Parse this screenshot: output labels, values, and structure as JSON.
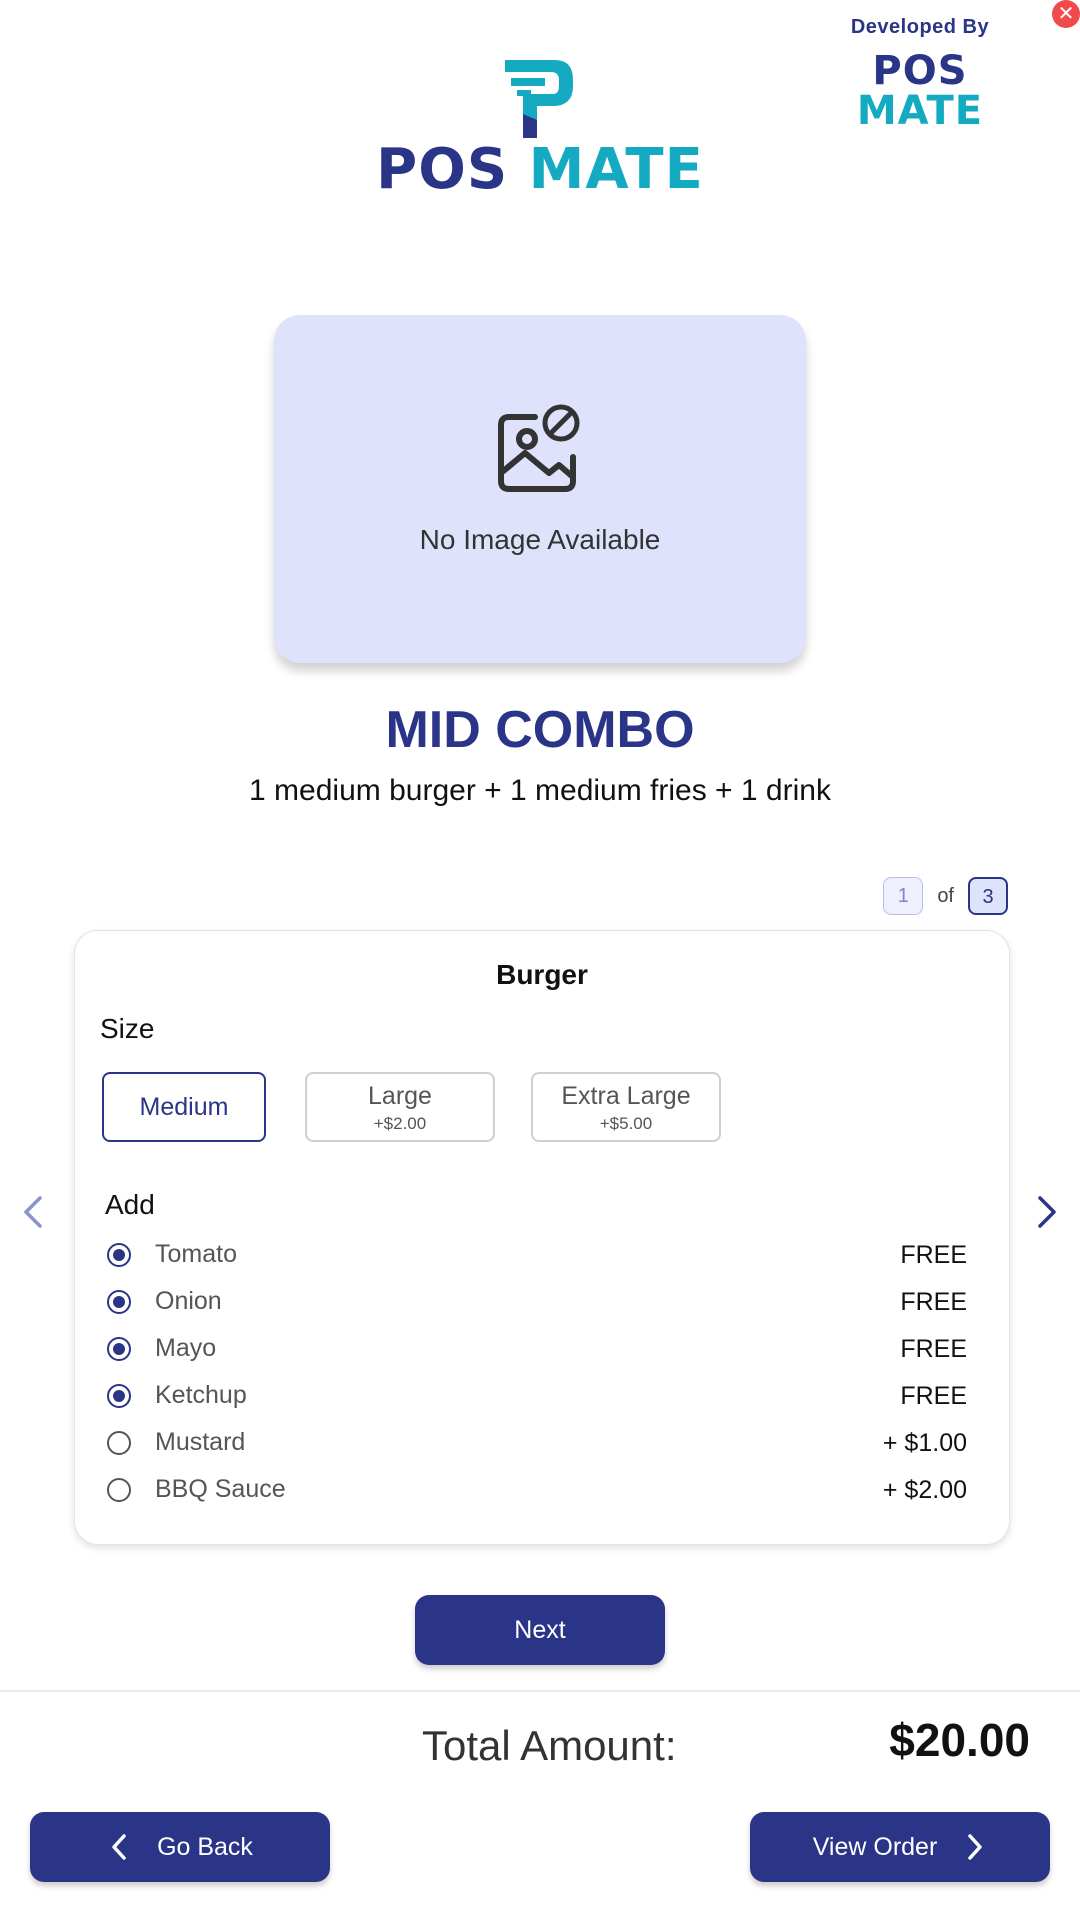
{
  "colors": {
    "primary": "#2a3588",
    "accent": "#13aac2",
    "close": "#f04a4a",
    "image_bg": "#dfe2fb"
  },
  "header": {
    "close_icon": "close-icon",
    "developed_by": {
      "label": "Developed By",
      "brand_a": "POS",
      "brand_b": "MATE"
    },
    "logo": {
      "brand_a": "POS",
      "brand_b": "MATE"
    }
  },
  "product": {
    "image_placeholder": "No Image Available",
    "image_icon": "no-image-icon",
    "title": "MID COMBO",
    "description": "1 medium burger + 1 medium fries + 1 drink"
  },
  "pager": {
    "current": "1",
    "of": "of",
    "total": "3"
  },
  "customize": {
    "title": "Burger",
    "size_label": "Size",
    "sizes": [
      {
        "name": "Medium",
        "price": "",
        "selected": true
      },
      {
        "name": "Large",
        "price": "+$2.00",
        "selected": false
      },
      {
        "name": "Extra Large",
        "price": "+$5.00",
        "selected": false
      }
    ],
    "add_label": "Add",
    "addons": [
      {
        "name": "Tomato",
        "price": "FREE",
        "checked": true
      },
      {
        "name": "Onion",
        "price": "FREE",
        "checked": true
      },
      {
        "name": "Mayo",
        "price": "FREE",
        "checked": true
      },
      {
        "name": "Ketchup",
        "price": "FREE",
        "checked": true
      },
      {
        "name": "Mustard",
        "price": "+ $1.00",
        "checked": false
      },
      {
        "name": "BBQ Sauce",
        "price": "+ $2.00",
        "checked": false
      }
    ]
  },
  "actions": {
    "next": "Next",
    "go_back": "Go Back",
    "view_order": "View Order"
  },
  "total": {
    "label": "Total Amount:",
    "value": "$20.00"
  }
}
